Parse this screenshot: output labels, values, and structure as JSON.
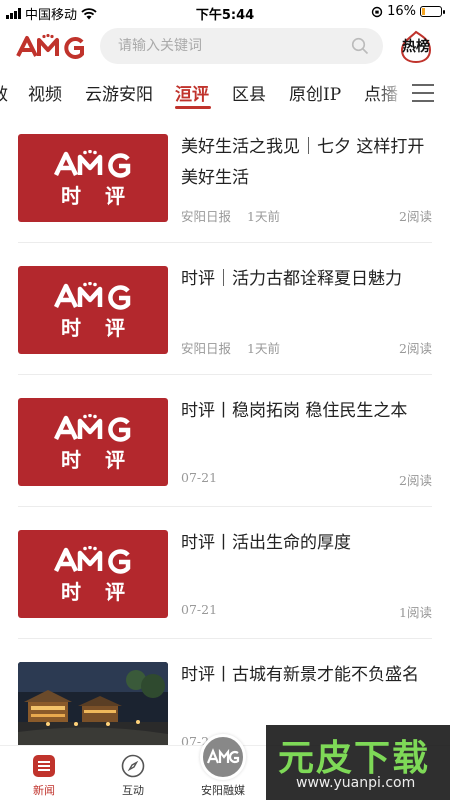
{
  "status_bar": {
    "carrier": "中国移动",
    "time": "下午5:44",
    "battery": "16%",
    "battery_level": 0.16
  },
  "header": {
    "logo_icon": "amg-logo",
    "search": {
      "placeholder": "请输入关键词",
      "value": ""
    },
    "hot_label": "热榜"
  },
  "tabs": {
    "items": [
      "效",
      "视频",
      "云游安阳",
      "洹评",
      "区县",
      "原创IP",
      "点播"
    ],
    "active": "洹评",
    "menu_icon": "hamburger-icon"
  },
  "news": [
    {
      "title": "美好生活之我见｜七夕 这样打开美好生活",
      "source": "安阳日报",
      "time": "1天前",
      "reads": "2阅读",
      "thumb": "AMG",
      "thumb_sub": "时评"
    },
    {
      "title": "时评｜活力古都诠释夏日魅力",
      "source": "安阳日报",
      "time": "1天前",
      "reads": "2阅读",
      "thumb": "AMG",
      "thumb_sub": "时评"
    },
    {
      "title": "时评丨稳岗拓岗 稳住民生之本",
      "source": "",
      "time": "07-21",
      "reads": "2阅读",
      "thumb": "AMG",
      "thumb_sub": "时评"
    },
    {
      "title": "时评丨活出生命的厚度",
      "source": "",
      "time": "07-21",
      "reads": "1阅读",
      "thumb": "AMG",
      "thumb_sub": "时评"
    },
    {
      "title": "时评丨古城有新景才能不负盛名",
      "source": "",
      "time": "07-2",
      "reads": "",
      "thumb": "photo-ancient-town-night",
      "thumb_sub": ""
    }
  ],
  "bottom_nav": [
    {
      "label": "新闻",
      "icon": "news-icon",
      "active": true
    },
    {
      "label": "互动",
      "icon": "compass-icon",
      "active": false
    },
    {
      "label": "安阳融媒",
      "icon": "amg-logo",
      "active": false
    }
  ],
  "watermark": {
    "text": "元皮下载",
    "url": "www.yuanpi.com"
  },
  "colors": {
    "accent": "#c0332c",
    "thumb_bg": "#b3282d",
    "meta": "#999999"
  }
}
